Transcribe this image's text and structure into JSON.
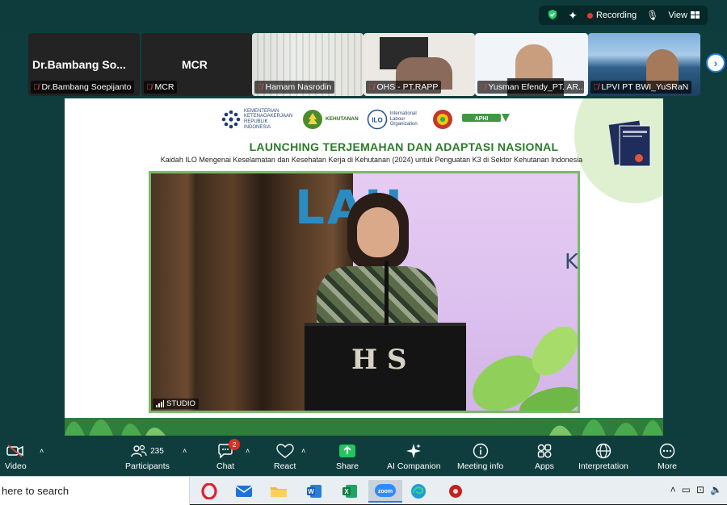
{
  "topbar": {
    "recording_label": "Recording",
    "view_label": "View"
  },
  "participants_strip": [
    {
      "big_name": "Dr.Bambang  So...",
      "label": "Dr.Bambang Soepijanto"
    },
    {
      "big_name": "MCR",
      "label": "MCR"
    },
    {
      "label": "Hamam Nasrodin"
    },
    {
      "label": "OHS - PT.RAPP"
    },
    {
      "label": "Yusman Efendy_PT. AR..."
    },
    {
      "label": "LPVI PT BWI_YuSRaN"
    }
  ],
  "slide": {
    "logos": [
      {
        "icon": "ministry-icon",
        "text": "KEMENTERIAN KETENAGAKERJAAN REPUBLIK INDONESIA"
      },
      {
        "icon": "forestry-icon",
        "text": "KEHUTANAN"
      },
      {
        "icon": "ilo-icon",
        "text": "International Labour Organization"
      },
      {
        "icon": "union-icon",
        "text": ""
      },
      {
        "icon": "apki-icon",
        "text": ""
      }
    ],
    "title": "LAUNCHING TERJEMAHAN DAN ADAPTASI NASIONAL",
    "subtitle": "Kaidah ILO Mengenai Keselamatan dan Kesehatan Kerja di Kehutanan (2024) untuk Penguatan K3 di Sektor Kehutanan Indonesia",
    "video_backdrop_text": "LAU",
    "video_backdrop_text2": "K",
    "podium_text": "H S",
    "studio_label": "STUDIO"
  },
  "toolbar": {
    "items": [
      {
        "label": "Video",
        "icon": "video-off-icon"
      },
      {
        "label": "Participants",
        "icon": "participants-icon",
        "count": "235"
      },
      {
        "label": "Chat",
        "icon": "chat-icon",
        "badge": "2"
      },
      {
        "label": "React",
        "icon": "heart-icon"
      },
      {
        "label": "Share",
        "icon": "share-icon"
      },
      {
        "label": "AI Companion",
        "icon": "sparkle-icon"
      },
      {
        "label": "Meeting info",
        "icon": "info-icon"
      },
      {
        "label": "Apps",
        "icon": "apps-icon"
      },
      {
        "label": "Interpretation",
        "icon": "globe-icon"
      },
      {
        "label": "More",
        "icon": "more-icon"
      }
    ]
  },
  "taskbar": {
    "search_text": "here to search",
    "apps": [
      "opera-icon",
      "mail-icon",
      "folder-icon",
      "word-icon",
      "excel-icon",
      "zoom-icon",
      "edge-icon",
      "app-icon"
    ]
  },
  "colors": {
    "zoom_bg": "#0f3d3d",
    "title_green": "#2b7a2b",
    "accent_blue": "#2a7de1",
    "record_red": "#e43a3a"
  }
}
